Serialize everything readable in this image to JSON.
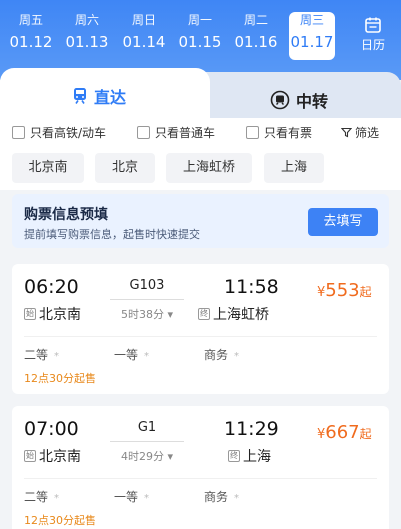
{
  "date_bar": {
    "days": [
      {
        "weekday": "周五",
        "date": "01.12",
        "selected": false
      },
      {
        "weekday": "周六",
        "date": "01.13",
        "selected": false
      },
      {
        "weekday": "周日",
        "date": "01.14",
        "selected": false
      },
      {
        "weekday": "周一",
        "date": "01.15",
        "selected": false
      },
      {
        "weekday": "周二",
        "date": "01.16",
        "selected": false
      },
      {
        "weekday": "周三",
        "date": "01.17",
        "selected": true
      }
    ],
    "calendar_label": "日历"
  },
  "tabs": {
    "direct": "直达",
    "transfer": "中转"
  },
  "filters": {
    "high_speed": "只看高铁/动车",
    "normal": "只看普通车",
    "has_ticket": "只看有票",
    "filter": "筛选"
  },
  "stations": [
    "北京南",
    "北京",
    "上海虹桥",
    "上海"
  ],
  "promo": {
    "title": "购票信息预填",
    "subtitle": "提前填写购票信息，起售时快速提交",
    "button": "去填写"
  },
  "trains": [
    {
      "depart_time": "06:20",
      "train_no": "G103",
      "duration": "5时38分",
      "arrive_time": "11:58",
      "price": "553",
      "price_prefix": "¥",
      "price_suffix": "起",
      "from_tag": "始",
      "from": "北京南",
      "to_tag": "终",
      "to": "上海虹桥",
      "seats": [
        "二等",
        "一等",
        "商务"
      ],
      "sale_time": "12点30分起售"
    },
    {
      "depart_time": "07:00",
      "train_no": "G1",
      "duration": "4时29分",
      "arrive_time": "11:29",
      "price": "667",
      "price_prefix": "¥",
      "price_suffix": "起",
      "from_tag": "始",
      "from": "北京南",
      "to_tag": "终",
      "to": "上海",
      "seats": [
        "二等",
        "一等",
        "商务"
      ],
      "sale_time": "12点30分起售"
    }
  ],
  "colors": {
    "primary": "#3d82f5",
    "price": "#f06b1e",
    "sale": "#e8891c"
  }
}
